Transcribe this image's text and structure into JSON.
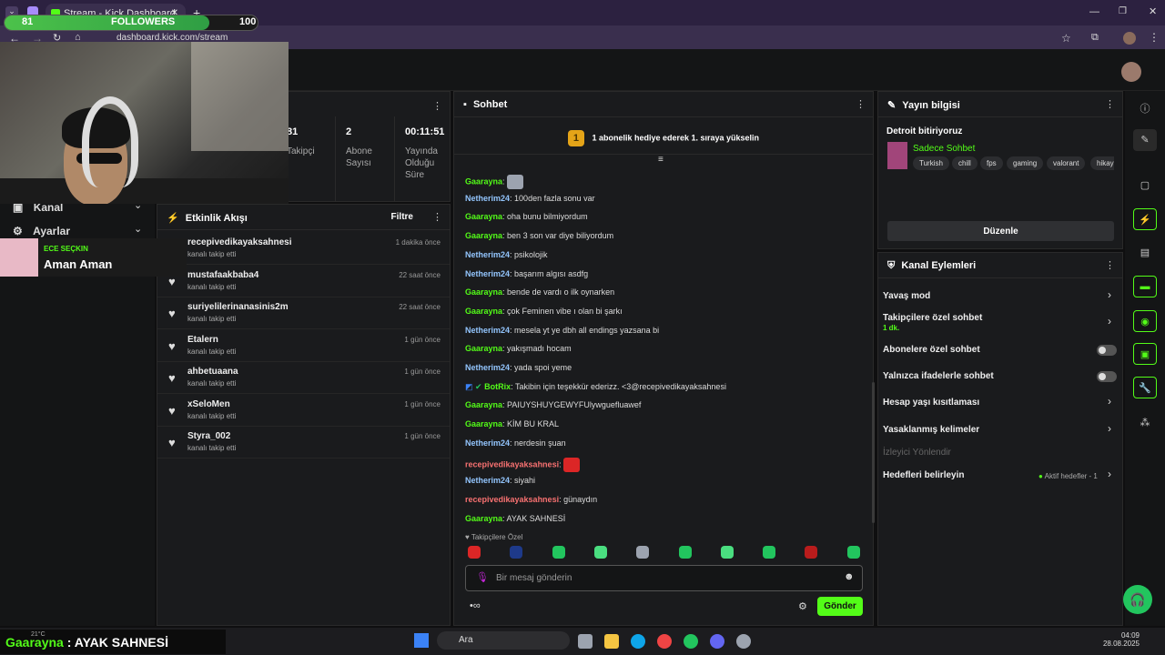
{
  "browser": {
    "tab_title": "Stream - Kick Dashboard",
    "new_tab": "+",
    "url": "dashboard.kick.com/stream"
  },
  "overlay": {
    "followers_current": "81",
    "followers_label": "FOLLOWERS",
    "followers_goal": "100",
    "followers_progress": 0.81,
    "streamer_tag": "ECE SEÇKIN",
    "streamer_title": "Aman Aman",
    "chat_user": "Gaarayna",
    "chat_sep": " : ",
    "chat_text": "AYAK SAHNESİ",
    "weather": "21°C"
  },
  "left_nav": {
    "channel": "Kanal",
    "settings": "Ayarlar"
  },
  "stats": {
    "followers_val": "81",
    "followers_lbl": "Takipçi",
    "subs_val": "2",
    "subs_lbl1": "Abone",
    "subs_lbl2": "Sayısı",
    "time_val": "00:11:51",
    "time_lbl1": "Yayında",
    "time_lbl2": "Olduğu",
    "time_lbl3": "Süre"
  },
  "activity": {
    "title": "Etkinlik Akışı",
    "filter": "Filtre",
    "items": [
      {
        "name": "recepivedikayaksahnesi",
        "sub": "kanalı takip etti",
        "time": "1 dakika önce"
      },
      {
        "name": "mustafaakbaba4",
        "sub": "kanalı takip etti",
        "time": "22 saat önce"
      },
      {
        "name": "suriyelilerinanasinis2m",
        "sub": "kanalı takip etti",
        "time": "22 saat önce"
      },
      {
        "name": "Etalern",
        "sub": "kanalı takip etti",
        "time": "1 gün önce"
      },
      {
        "name": "ahbetuaana",
        "sub": "kanalı takip etti",
        "time": "1 gün önce"
      },
      {
        "name": "xSeloMen",
        "sub": "kanalı takip etti",
        "time": "1 gün önce"
      },
      {
        "name": "Styra_002",
        "sub": "kanalı takip etti",
        "time": "1 gün önce"
      }
    ]
  },
  "chat": {
    "title": "Sohbet",
    "promo_rank": "1",
    "promo_text": "1 abonelik hediye ederek 1. sıraya yükselin",
    "messages": [
      {
        "user": "Gaarayna",
        "text": "",
        "color": "#53fc18"
      },
      {
        "user": "Netherim24",
        "text": "100den fazla sonu var",
        "color": "#93c5fd"
      },
      {
        "user": "Gaarayna",
        "text": "oha bunu bilmiyordum",
        "color": "#53fc18"
      },
      {
        "user": "Gaarayna",
        "text": "ben 3 son var diye biliyordum",
        "color": "#53fc18"
      },
      {
        "user": "Netherim24",
        "text": "psikolojik",
        "color": "#93c5fd"
      },
      {
        "user": "Netherim24",
        "text": "başarım algısı asdfg",
        "color": "#93c5fd"
      },
      {
        "user": "Gaarayna",
        "text": "bende de vardı o ilk oynarken",
        "color": "#53fc18"
      },
      {
        "user": "Gaarayna",
        "text": "çok Feminen vibe ı olan bi şarkı",
        "color": "#53fc18"
      },
      {
        "user": "Netherim24",
        "text": "mesela yt ye dbh all endings yazsana bi",
        "color": "#93c5fd"
      },
      {
        "user": "Gaarayna",
        "text": "yakışmadı hocam",
        "color": "#53fc18"
      },
      {
        "user": "Netherim24",
        "text": "yada spoi yeme",
        "color": "#93c5fd"
      },
      {
        "user": "BotRix",
        "text": "Takibin için teşekkür ederizz. <3@recepivedikayaksahnesi",
        "color": "#53fc18"
      },
      {
        "user": "Gaarayna",
        "text": "PAIUYSHUYGEWYFUlywguefluawef",
        "color": "#53fc18"
      },
      {
        "user": "Gaarayna",
        "text": "KİM BU KRAL",
        "color": "#53fc18"
      },
      {
        "user": "Netherim24",
        "text": "nerdesin şuan",
        "color": "#93c5fd"
      },
      {
        "user": "recepivedikayaksahnesi",
        "text": "",
        "color": "#f87171"
      },
      {
        "user": "Netherim24",
        "text": "siyahi",
        "color": "#93c5fd"
      },
      {
        "user": "recepivedikayaksahnesi",
        "text": "günaydın",
        "color": "#f87171"
      },
      {
        "user": "Gaarayna",
        "text": "AYAK SAHNESİ",
        "color": "#53fc18"
      }
    ],
    "followers_only": "Takipçilere Özel",
    "input_placeholder": "Bir mesaj gönderin",
    "send": "Gönder"
  },
  "stream_info": {
    "title": "Yayın bilgisi",
    "stream_title": "Detroit bitiriyoruz",
    "category": "Sadece Sohbet",
    "tags": [
      "Turkish",
      "chill",
      "fps",
      "gaming",
      "valorant",
      "hikay"
    ],
    "edit": "Düzenle"
  },
  "channel_actions": {
    "title": "Kanal Eylemleri",
    "slow_mode": "Yavaş mod",
    "followers_chat": "Takipçilere özel sohbet",
    "followers_chat_val": "1 dk.",
    "subs_chat": "Abonelere özel sohbet",
    "emote_chat": "Yalnızca ifadelerle sohbet",
    "age_limit": "Hesap yaşı kısıtlaması",
    "banned_words": "Yasaklanmış kelimeler",
    "viewer_redirect": "İzleyici Yönlendir",
    "goals": "Hedefleri belirleyin",
    "goals_status": "Aktif hedefler - 1"
  },
  "taskbar": {
    "search": "Ara",
    "time": "04:09",
    "date": "28.08.2025"
  }
}
